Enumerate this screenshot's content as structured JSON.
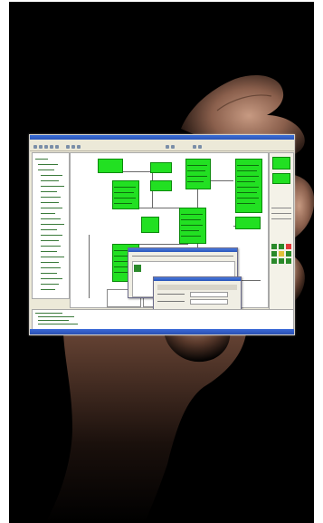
{
  "scene": {
    "description_icon": "hand-holding-screenshot",
    "background_color": "#000000"
  },
  "screenshot_colors": {
    "entity_fill": "#22e022",
    "entity_border": "#0a8a0a",
    "window_chrome": "#ece9d8",
    "titlebar": "#2b55b8"
  }
}
